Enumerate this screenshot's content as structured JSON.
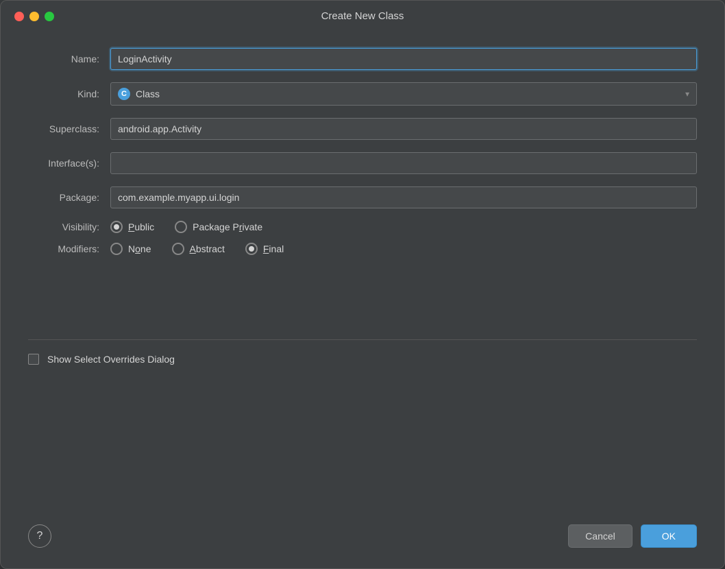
{
  "window": {
    "title": "Create New Class",
    "controls": {
      "close": "close",
      "minimize": "minimize",
      "maximize": "maximize"
    }
  },
  "form": {
    "name_label": "Name:",
    "name_value": "LoginActivity",
    "name_placeholder": "",
    "kind_label": "Kind:",
    "kind_value": "Class",
    "kind_icon": "C",
    "superclass_label": "Superclass:",
    "superclass_value": "android.app.Activity",
    "interfaces_label": "Interface(s):",
    "interfaces_value": "",
    "package_label": "Package:",
    "package_value": "com.example.myapp.ui.login",
    "visibility_label": "Visibility:",
    "visibility_options": [
      {
        "id": "public",
        "label": "Public",
        "underline_char": "u",
        "selected": true
      },
      {
        "id": "package-private",
        "label": "Package Private",
        "underline_char": "r",
        "selected": false
      }
    ],
    "modifiers_label": "Modifiers:",
    "modifiers_options": [
      {
        "id": "none",
        "label": "None",
        "underline_char": "o",
        "selected": false
      },
      {
        "id": "abstract",
        "label": "Abstract",
        "underline_char": "A",
        "selected": false
      },
      {
        "id": "final",
        "label": "Final",
        "underline_char": "F",
        "selected": true
      }
    ],
    "show_overrides_label": "Show Select Overrides Dialog",
    "show_overrides_checked": false
  },
  "footer": {
    "help_label": "?",
    "cancel_label": "Cancel",
    "ok_label": "OK"
  }
}
